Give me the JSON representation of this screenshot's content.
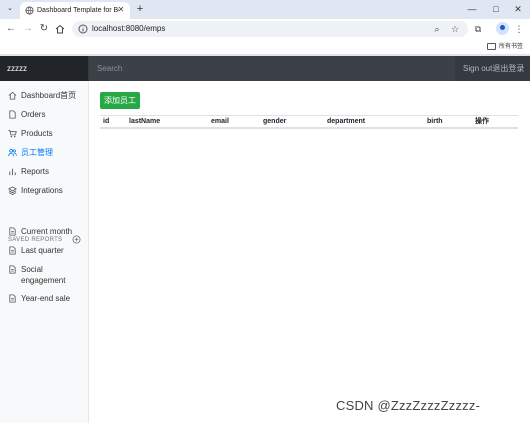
{
  "browser": {
    "tab_title": "Dashboard Template for Boo",
    "url": "localhost:8080/emps",
    "bookmarks_folder": "所有书签",
    "icons": {
      "tab_search": "chevron-down-icon",
      "favicon": "globe-icon",
      "back": "arrow-left-icon",
      "forward": "arrow-right-icon",
      "reload": "reload-icon",
      "home": "home-icon",
      "zoom": "zoom-icon",
      "bookmark": "star-icon",
      "extensions": "puzzle-icon",
      "menu": "kebab-icon"
    }
  },
  "navbar": {
    "brand": "zzzzz",
    "search_placeholder": "Search",
    "signout": "Sign out退出登录"
  },
  "sidebar": {
    "items": [
      {
        "label": "Dashboard首页",
        "icon": "home-icon",
        "active": false
      },
      {
        "label": "Orders",
        "icon": "file-icon",
        "active": false
      },
      {
        "label": "Products",
        "icon": "cart-icon",
        "active": false
      },
      {
        "label": "员工管理",
        "icon": "users-icon",
        "active": true
      },
      {
        "label": "Reports",
        "icon": "bar-chart-icon",
        "active": false
      },
      {
        "label": "Integrations",
        "icon": "layers-icon",
        "active": false
      }
    ],
    "saved_reports_heading": "SAVED REPORTS",
    "saved_reports": [
      {
        "label": "Current month",
        "icon": "file-text-icon"
      },
      {
        "label": "Last quarter",
        "icon": "file-text-icon"
      },
      {
        "label": "Social engagement",
        "icon": "file-text-icon"
      },
      {
        "label": "Year-end sale",
        "icon": "file-text-icon"
      }
    ]
  },
  "main": {
    "add_button": "添加员工",
    "columns": [
      "id",
      "lastName",
      "email",
      "gender",
      "department",
      "birth",
      "操作"
    ],
    "rows": []
  },
  "watermark": "CSDN @ZzzZzzzZzzzz-",
  "colors": {
    "navbar": "#343a40",
    "brand_bg": "#212529",
    "accent": "#007bff",
    "add_button": "#28a745"
  }
}
